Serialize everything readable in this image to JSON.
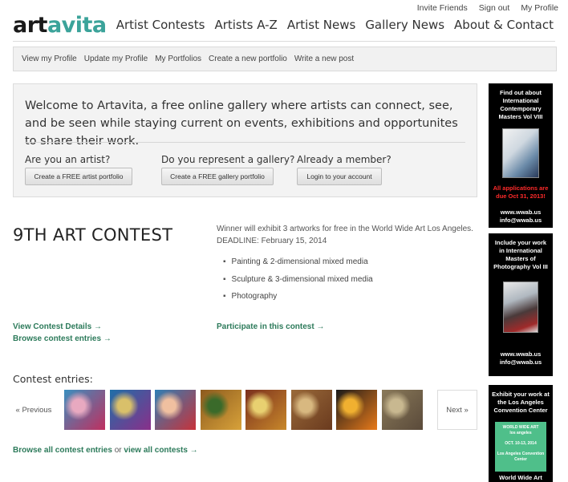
{
  "top_links": [
    "Invite Friends",
    "Sign out",
    "My Profile"
  ],
  "logo": {
    "part1": "art",
    "part2": "avita"
  },
  "main_nav": [
    "Artist Contests",
    "Artists A-Z",
    "Artist News",
    "Gallery News",
    "About & Contact"
  ],
  "sub_nav": [
    "View my Profile",
    "Update my Profile",
    "My Portfolios",
    "Create a new portfolio",
    "Write a new post"
  ],
  "welcome": {
    "message": "Welcome to Artavita, a free online gallery where artists can connect, see, and be seen while staying current on events, exhibitions and opportunites to share their work.",
    "q1": "Are you an artist?",
    "btn1": "Create a FREE artist portfolio",
    "q2": "Do you represent a gallery?",
    "btn2": "Create a FREE gallery portfolio",
    "q3": "Already a member?",
    "btn3": "Login to your account"
  },
  "contest": {
    "title": "9TH ART CONTEST",
    "description": "Winner will exhibit 3 artworks for free in the World Wide Art Los Angeles.",
    "deadline": "DEADLINE: February 15, 2014",
    "categories": [
      "Painting & 2-dimensional mixed media",
      "Sculpture & 3-dimensional mixed media",
      "Photography"
    ],
    "details_link": "View Contest Details →",
    "browse_link": "Browse contest entries →",
    "participate_link": "Participate in this contest →"
  },
  "entries": {
    "label": "Contest entries:",
    "previous": "« Previous",
    "next": "Next »",
    "browse_all": "Browse all contest entries",
    "or": "or",
    "view_all": "view all contests →",
    "thumb_colors": [
      [
        "#3a8fbf",
        "#c02f5f",
        "#e8a9c0"
      ],
      [
        "#1e6fa8",
        "#8a2f8a",
        "#d9c06a"
      ],
      [
        "#2f7fb5",
        "#c8323a",
        "#f0c0a0"
      ],
      [
        "#8c5a1e",
        "#d8a23a",
        "#3a6a2a"
      ],
      [
        "#7a2f1e",
        "#c8882a",
        "#e8d070"
      ],
      [
        "#9a6a3a",
        "#6a3a1e",
        "#d8b880"
      ],
      [
        "#1a1a1a",
        "#e87a1a",
        "#f0b030"
      ],
      [
        "#8a7a5a",
        "#5a4a3a",
        "#c8b890"
      ]
    ]
  },
  "ads": [
    {
      "text": "Find out about International Contemporary Masters Vol VIII",
      "red": "All applications are due Oct 31, 2013!",
      "site": "www.wwab.us",
      "email": "info@wwab.us"
    },
    {
      "text": "Include your work in International Masters of Photography Vol III",
      "site": "www.wwab.us",
      "email": "info@wwab.us"
    },
    {
      "text": "Exhibit your work at the Los Angeles Convention Center",
      "poster_title": "WORLD WIDE ART",
      "poster_city": "los angeles",
      "poster_dates": "OCT. 10-13, 2014",
      "poster_venue": "Los Angeles Convention Center",
      "footer": "World Wide Art"
    }
  ]
}
